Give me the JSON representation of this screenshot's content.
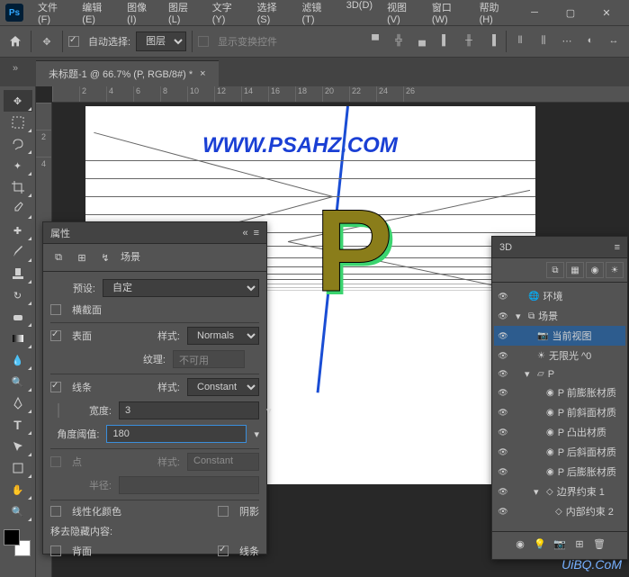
{
  "menu": [
    "文件(F)",
    "编辑(E)",
    "图像(I)",
    "图层(L)",
    "文字(Y)",
    "选择(S)",
    "滤镜(T)",
    "3D(D)",
    "视图(V)",
    "窗口(W)",
    "帮助(H)"
  ],
  "options": {
    "auto_select": "自动选择:",
    "layer_dropdown": "图层",
    "transform_controls": "显示变换控件"
  },
  "doc_tab": "未标题-1 @ 66.7% (P, RGB/8#) *",
  "ruler_h": [
    "",
    "2",
    "4",
    "6",
    "8",
    "10",
    "12",
    "14",
    "16",
    "18",
    "20",
    "22",
    "24",
    "26"
  ],
  "ruler_v": [
    "",
    "2",
    "4"
  ],
  "canvas": {
    "watermark": "WWW.PSAHZ.COM",
    "letter": "P"
  },
  "props_panel": {
    "title": "属性",
    "breadcrumb": "场景",
    "preset_label": "预设:",
    "preset_value": "自定",
    "cross_section": "横截面",
    "surface": "表面",
    "style_label": "样式:",
    "surface_style": "Normals",
    "texture_label": "纹理:",
    "texture_value": "不可用",
    "lines": "线条",
    "lines_style": "Constant",
    "width_label": "宽度:",
    "width_value": "3",
    "angle_label": "角度阈值:",
    "angle_value": "180",
    "points": "点",
    "points_style": "Constant",
    "radius_label": "半径:",
    "radius_value": "",
    "linearize": "线性化颜色",
    "shadow": "阴影",
    "move_hidden": "移去隐藏内容:",
    "backface": "背面",
    "lines2": "线条"
  },
  "threed_panel": {
    "title": "3D",
    "items": [
      {
        "label": "环境",
        "indent": 0,
        "icon": "env"
      },
      {
        "label": "场景",
        "indent": 0,
        "icon": "scene",
        "expanded": true
      },
      {
        "label": "当前视图",
        "indent": 1,
        "icon": "camera",
        "selected": true
      },
      {
        "label": "无限光 ^0",
        "indent": 1,
        "icon": "light"
      },
      {
        "label": "P",
        "indent": 1,
        "icon": "mesh",
        "expanded": true
      },
      {
        "label": "P 前膨胀材质",
        "indent": 2,
        "icon": "mat"
      },
      {
        "label": "P 前斜面材质",
        "indent": 2,
        "icon": "mat"
      },
      {
        "label": "P 凸出材质",
        "indent": 2,
        "icon": "mat"
      },
      {
        "label": "P 后斜面材质",
        "indent": 2,
        "icon": "mat"
      },
      {
        "label": "P 后膨胀材质",
        "indent": 2,
        "icon": "mat"
      },
      {
        "label": "边界约束 1",
        "indent": 2,
        "icon": "constraint",
        "expanded": true
      },
      {
        "label": "内部约束 2",
        "indent": 3,
        "icon": "constraint"
      }
    ]
  },
  "corner_watermark": "UiBQ.CoM"
}
